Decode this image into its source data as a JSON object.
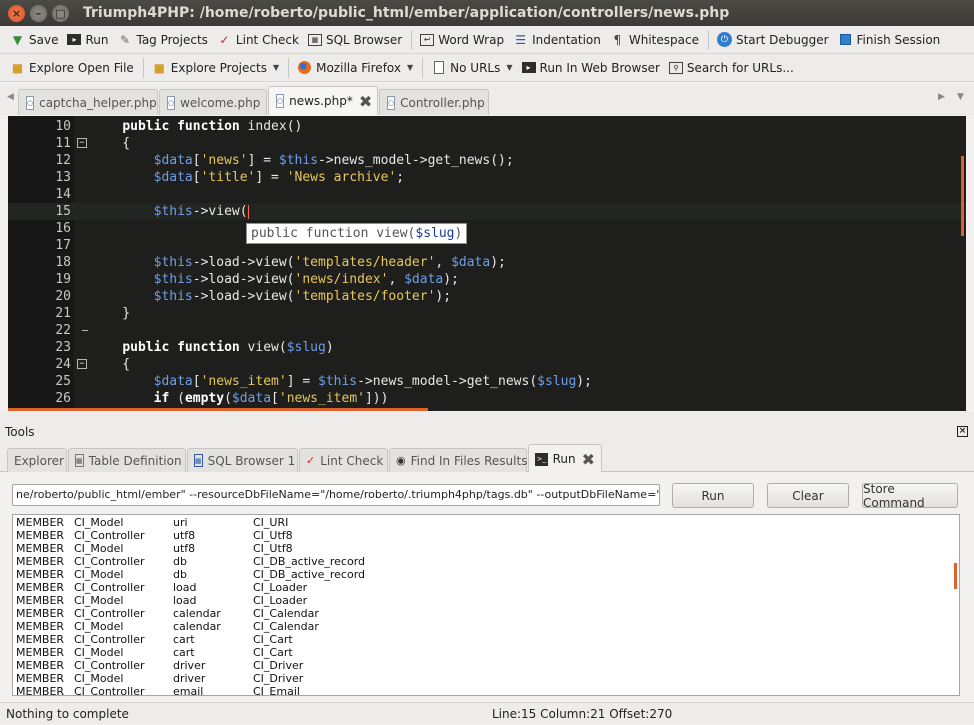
{
  "window": {
    "title": "Triumph4PHP: /home/roberto/public_html/ember/application/controllers/news.php",
    "buttons": [
      "×",
      "–",
      "□"
    ]
  },
  "toolbar1": [
    {
      "icon": "save-icon",
      "label": "Save"
    },
    {
      "icon": "run-icon",
      "label": "Run"
    },
    {
      "icon": "tag-icon",
      "label": "Tag Projects"
    },
    {
      "icon": "check-icon",
      "label": "Lint Check"
    },
    {
      "icon": "database-icon",
      "label": "SQL Browser"
    },
    {
      "icon": "word-wrap-icon",
      "label": "Word Wrap"
    },
    {
      "icon": "indentation-icon",
      "label": "Indentation"
    },
    {
      "icon": "pilcrow-icon",
      "label": "Whitespace"
    },
    {
      "icon": "power-icon",
      "label": "Start Debugger"
    },
    {
      "icon": "stop-icon",
      "label": "Finish Session"
    }
  ],
  "toolbar2": [
    {
      "icon": "folder-icon",
      "label": "Explore Open File"
    },
    {
      "icon": "folder-icon",
      "label": "Explore Projects"
    },
    {
      "icon": "firefox-icon",
      "label": "Mozilla Firefox"
    },
    {
      "icon": "page-icon",
      "label": "No URLs"
    },
    {
      "icon": "run-web-icon",
      "label": "Run In Web Browser"
    },
    {
      "icon": "search-url-icon",
      "label": "Search for URLs..."
    }
  ],
  "editor_tabs": [
    {
      "label": "captcha_helper.php",
      "active": false
    },
    {
      "label": "welcome.php",
      "active": false
    },
    {
      "label": "news.php*",
      "active": true
    },
    {
      "label": "Controller.php",
      "active": false
    }
  ],
  "code_lines": [
    {
      "num": "10",
      "tokens": [
        [
          "p",
          "    "
        ],
        [
          "k",
          "public"
        ],
        [
          "p",
          " "
        ],
        [
          "k",
          "function"
        ],
        [
          "p",
          " index()"
        ]
      ]
    },
    {
      "num": "11",
      "fold": "open",
      "tokens": [
        [
          "p",
          "    {"
        ]
      ]
    },
    {
      "num": "12",
      "tokens": [
        [
          "p",
          "        "
        ],
        [
          "v",
          "$data"
        ],
        [
          "p",
          "["
        ],
        [
          "s",
          "'news'"
        ],
        [
          "p",
          "] = "
        ],
        [
          "v",
          "$this"
        ],
        [
          "p",
          "->news_model->get_news();"
        ]
      ]
    },
    {
      "num": "13",
      "tokens": [
        [
          "p",
          "        "
        ],
        [
          "v",
          "$data"
        ],
        [
          "p",
          "["
        ],
        [
          "s",
          "'title'"
        ],
        [
          "p",
          "] = "
        ],
        [
          "s",
          "'News archive'"
        ],
        [
          "p",
          ";"
        ]
      ]
    },
    {
      "num": "14",
      "tokens": []
    },
    {
      "num": "15",
      "current": true,
      "caret": true,
      "tokens": [
        [
          "p",
          "        "
        ],
        [
          "v",
          "$this"
        ],
        [
          "p",
          "->view("
        ]
      ]
    },
    {
      "num": "16",
      "tokens": []
    },
    {
      "num": "17",
      "tokens": []
    },
    {
      "num": "18",
      "tokens": [
        [
          "p",
          "        "
        ],
        [
          "v",
          "$this"
        ],
        [
          "p",
          "->load->view("
        ],
        [
          "s",
          "'templates/header'"
        ],
        [
          "p",
          ", "
        ],
        [
          "v",
          "$data"
        ],
        [
          "p",
          ");"
        ]
      ]
    },
    {
      "num": "19",
      "tokens": [
        [
          "p",
          "        "
        ],
        [
          "v",
          "$this"
        ],
        [
          "p",
          "->load->view("
        ],
        [
          "s",
          "'news/index'"
        ],
        [
          "p",
          ", "
        ],
        [
          "v",
          "$data"
        ],
        [
          "p",
          ");"
        ]
      ]
    },
    {
      "num": "20",
      "tokens": [
        [
          "p",
          "        "
        ],
        [
          "v",
          "$this"
        ],
        [
          "p",
          "->load->view("
        ],
        [
          "s",
          "'templates/footer'"
        ],
        [
          "p",
          ");"
        ]
      ]
    },
    {
      "num": "21",
      "tokens": [
        [
          "p",
          "    }"
        ]
      ]
    },
    {
      "num": "22",
      "fold": "end",
      "tokens": []
    },
    {
      "num": "23",
      "tokens": [
        [
          "p",
          "    "
        ],
        [
          "k",
          "public"
        ],
        [
          "p",
          " "
        ],
        [
          "k",
          "function"
        ],
        [
          "p",
          " view("
        ],
        [
          "v",
          "$slug"
        ],
        [
          "p",
          ")"
        ]
      ]
    },
    {
      "num": "24",
      "fold": "open",
      "tokens": [
        [
          "p",
          "    {"
        ]
      ]
    },
    {
      "num": "25",
      "tokens": [
        [
          "p",
          "        "
        ],
        [
          "v",
          "$data"
        ],
        [
          "p",
          "["
        ],
        [
          "s",
          "'news_item'"
        ],
        [
          "p",
          "] = "
        ],
        [
          "v",
          "$this"
        ],
        [
          "p",
          "->news_model->get_news("
        ],
        [
          "v",
          "$slug"
        ],
        [
          "p",
          ");"
        ]
      ]
    },
    {
      "num": "26",
      "tokens": [
        [
          "p",
          "        "
        ],
        [
          "k",
          "if"
        ],
        [
          "p",
          " ("
        ],
        [
          "k",
          "empty"
        ],
        [
          "p",
          "("
        ],
        [
          "v",
          "$data"
        ],
        [
          "p",
          "["
        ],
        [
          "s",
          "'news_item'"
        ],
        [
          "p",
          "]))"
        ]
      ]
    }
  ],
  "calltip": {
    "prefix": "public function view(",
    "param": "$slug",
    "suffix": ")"
  },
  "tools": {
    "header": "Tools",
    "close": "×",
    "tabs": [
      {
        "icon": "",
        "label": "Explorer",
        "active": false
      },
      {
        "icon": "table-icon",
        "label": "Table Definition",
        "active": false
      },
      {
        "icon": "database-icon",
        "label": "SQL Browser 1",
        "active": false
      },
      {
        "icon": "check-icon",
        "label": "Lint Check",
        "active": false
      },
      {
        "icon": "binoculars-icon",
        "label": "Find In Files Results",
        "active": false
      },
      {
        "icon": "terminal-icon",
        "label": "Run",
        "active": true
      }
    ]
  },
  "run": {
    "command": "ne/roberto/public_html/ember\" --resourceDbFileName=\"/home/roberto/.triumph4php/tags.db\" --outputDbFileName=\"\"",
    "run_label": "Run",
    "clear_label": "Clear",
    "store_label": "Store Command",
    "output": [
      [
        "MEMBER",
        "CI_Model",
        "uri",
        "CI_URI"
      ],
      [
        "MEMBER",
        "CI_Controller",
        "utf8",
        "CI_Utf8"
      ],
      [
        "MEMBER",
        "CI_Model",
        "utf8",
        "CI_Utf8"
      ],
      [
        "MEMBER",
        "CI_Controller",
        "db",
        "CI_DB_active_record"
      ],
      [
        "MEMBER",
        "CI_Model",
        "db",
        "CI_DB_active_record"
      ],
      [
        "MEMBER",
        "CI_Controller",
        "load",
        "CI_Loader"
      ],
      [
        "MEMBER",
        "CI_Model",
        "load",
        "CI_Loader"
      ],
      [
        "MEMBER",
        "CI_Controller",
        "calendar",
        "CI_Calendar"
      ],
      [
        "MEMBER",
        "CI_Model",
        "calendar",
        "CI_Calendar"
      ],
      [
        "MEMBER",
        "CI_Controller",
        "cart",
        "CI_Cart"
      ],
      [
        "MEMBER",
        "CI_Model",
        "cart",
        "CI_Cart"
      ],
      [
        "MEMBER",
        "CI_Controller",
        "driver",
        "CI_Driver"
      ],
      [
        "MEMBER",
        "CI_Model",
        "driver",
        "CI_Driver"
      ],
      [
        "MEMBER",
        "CI_Controller",
        "email",
        "CI_Email"
      ]
    ]
  },
  "status": {
    "left": "Nothing to complete",
    "right": "Line:15 Column:21 Offset:270"
  }
}
